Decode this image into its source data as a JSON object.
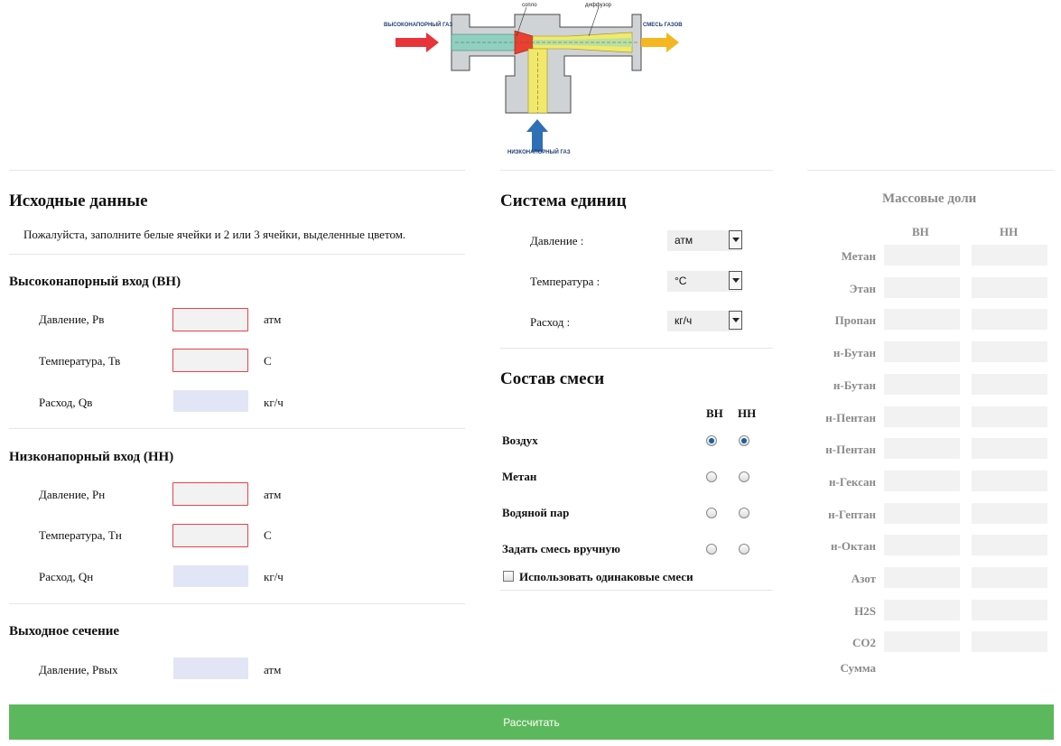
{
  "diagram": {
    "label_high": "ВЫСОКОНАПОРНЫЙ ГАЗ",
    "label_low": "НИЗКОНАПОРНЫЙ ГАЗ",
    "label_mix": "СМЕСЬ ГАЗОВ",
    "label_nozzle": "сопло",
    "label_diffuser": "диффузор",
    "colors": {
      "high_arrow": "#e8333a",
      "low_arrow": "#2f6fb6",
      "mix_arrow": "#f5b71f",
      "high_gas": "#8fd0c0",
      "low_gas": "#f2e96a"
    }
  },
  "input": {
    "title": "Исходные данные",
    "hint": "Пожалуйста, заполните белые ячейки и 2 или 3 ячейки, выделенные цветом.",
    "high": {
      "title": "Высоконапорный вход (ВН)",
      "rows": [
        {
          "label": "Давление, Рв",
          "unit": "атм",
          "value": ""
        },
        {
          "label": "Температура, Тв",
          "unit": "С",
          "value": ""
        },
        {
          "label": "Расход, Qв",
          "unit": "кг/ч",
          "value": ""
        }
      ]
    },
    "low": {
      "title": "Низконапорный вход (НН)",
      "rows": [
        {
          "label": "Давление, Рн",
          "unit": "атм",
          "value": ""
        },
        {
          "label": "Температура, Тн",
          "unit": "С",
          "value": ""
        },
        {
          "label": "Расход, Qн",
          "unit": "кг/ч",
          "value": ""
        }
      ]
    },
    "outlet": {
      "title": "Выходное сечение",
      "rows": [
        {
          "label": "Давление, Рвых",
          "unit": "атм",
          "value": ""
        }
      ]
    }
  },
  "units": {
    "title": "Система единиц",
    "rows": [
      {
        "label": "Давление :",
        "selected": "атм"
      },
      {
        "label": "Температура :",
        "selected": "°C"
      },
      {
        "label": "Расход :",
        "selected": "кг/ч"
      }
    ]
  },
  "mixture": {
    "title": "Состав смеси",
    "col_high": "ВН",
    "col_low": "НН",
    "rows": [
      {
        "label": "Воздух",
        "high": true,
        "low": true
      },
      {
        "label": "Метан",
        "high": false,
        "low": false
      },
      {
        "label": "Водяной пар",
        "high": false,
        "low": false
      },
      {
        "label": "Задать смесь вручную",
        "high": false,
        "low": false
      }
    ],
    "same_mix_label": "Использовать одинаковые смеси",
    "same_mix_checked": false
  },
  "mass": {
    "title": "Массовые доли",
    "col_high": "ВН",
    "col_low": "НН",
    "rows": [
      "Метан",
      "Этан",
      "Пропан",
      "н-Бутан",
      "н-Бутан",
      "н-Пентан",
      "н-Пентан",
      "н-Гексан",
      "н-Гептан",
      "н-Октан",
      "Азот",
      "H2S",
      "CO2"
    ],
    "sum_label": "Сумма"
  },
  "calc_button": "Рассчитать"
}
